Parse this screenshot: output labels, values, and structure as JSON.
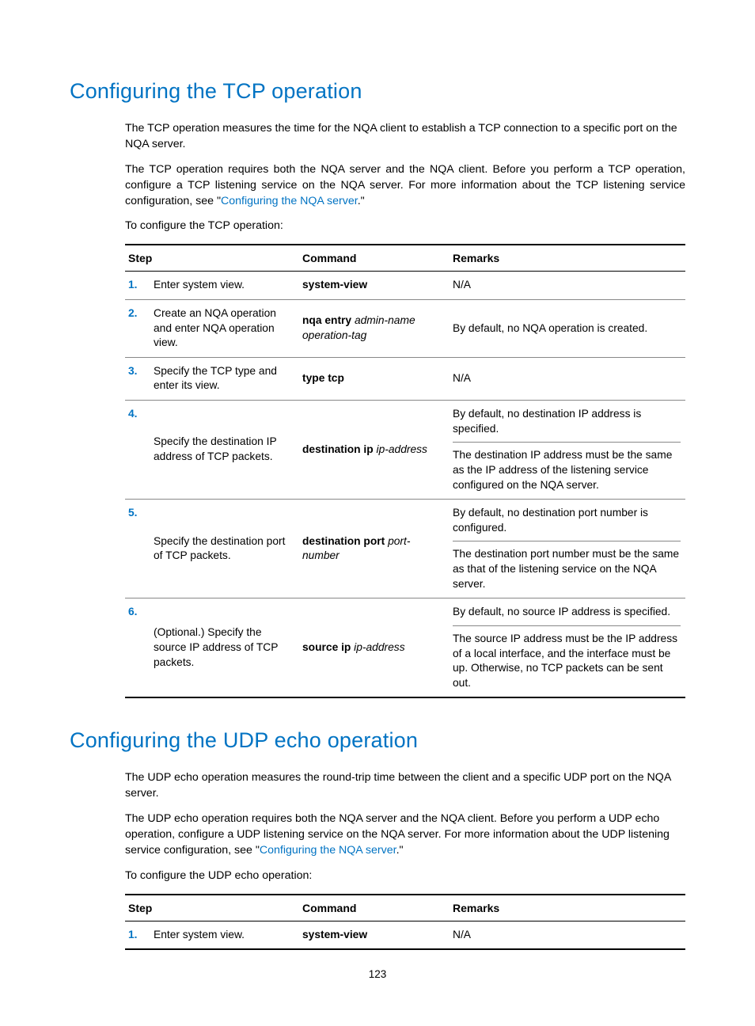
{
  "section1": {
    "heading": "Configuring the TCP operation",
    "para1": "The TCP operation measures the time for the NQA client to establish a TCP connection to a specific port on the NQA server.",
    "para2_a": "The TCP operation requires both the NQA server and the NQA client. Before you perform a TCP operation, configure a TCP listening service on the NQA server. For more information about the TCP listening service configuration, see \"",
    "para2_link": "Configuring the NQA server",
    "para2_b": ".\"",
    "lead": "To configure the TCP operation:",
    "table": {
      "headers": {
        "step": "Step",
        "command": "Command",
        "remarks": "Remarks"
      },
      "rows": [
        {
          "num": "1.",
          "desc": "Enter system view.",
          "cmd_bold": "system-view",
          "remarks_single": "N/A"
        },
        {
          "num": "2.",
          "desc": "Create an NQA operation and enter NQA operation view.",
          "cmd_bold": "nqa entry",
          "cmd_italic": " admin-name operation-tag",
          "remarks_single": "By default, no NQA operation is created."
        },
        {
          "num": "3.",
          "desc": "Specify the TCP type and enter its view.",
          "cmd_bold": "type tcp",
          "remarks_single": "N/A"
        },
        {
          "num": "4.",
          "desc": "Specify the destination IP address of TCP packets.",
          "cmd_bold": "destination ip",
          "cmd_italic": " ip-address",
          "remarks_a": "By default, no destination IP address is specified.",
          "remarks_b": "The destination IP address must be the same as the IP address of the listening service configured on the NQA server."
        },
        {
          "num": "5.",
          "desc": "Specify the destination port of TCP packets.",
          "cmd_bold": "destination port",
          "cmd_italic": " port-number",
          "remarks_a": "By default, no destination port number is configured.",
          "remarks_b": "The destination port number must be the same as that of the listening service on the NQA server."
        },
        {
          "num": "6.",
          "desc": "(Optional.) Specify the source IP address of TCP packets.",
          "cmd_bold": "source ip",
          "cmd_italic": " ip-address",
          "remarks_a": "By default, no source IP address is specified.",
          "remarks_b": "The source IP address must be the IP address of a local interface, and the interface must be up. Otherwise, no TCP packets can be sent out."
        }
      ]
    }
  },
  "section2": {
    "heading": "Configuring the UDP echo operation",
    "para1": "The UDP echo operation measures the round-trip time between the client and a specific UDP port on the NQA server.",
    "para2_a": "The UDP echo operation requires both the NQA server and the NQA client. Before you perform a UDP echo operation, configure a UDP listening service on the NQA server. For more information about the UDP listening service configuration, see \"",
    "para2_link": "Configuring the NQA server",
    "para2_b": ".\"",
    "lead": "To configure the UDP echo operation:",
    "table": {
      "headers": {
        "step": "Step",
        "command": "Command",
        "remarks": "Remarks"
      },
      "rows": [
        {
          "num": "1.",
          "desc": "Enter system view.",
          "cmd_bold": "system-view",
          "remarks_single": "N/A"
        }
      ]
    }
  },
  "page_number": "123"
}
